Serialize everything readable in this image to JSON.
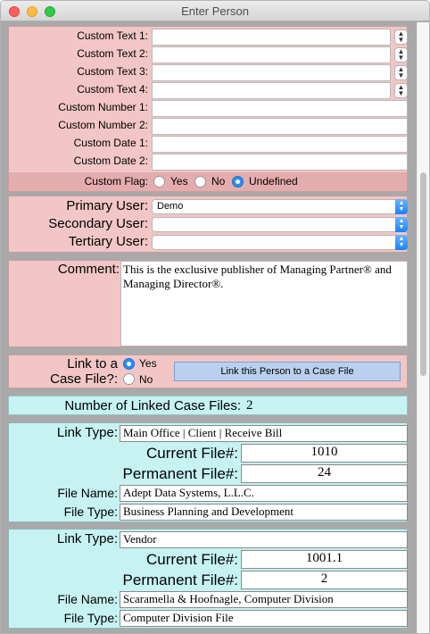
{
  "window": {
    "title": "Enter Person"
  },
  "custom": {
    "text1_label": "Custom Text 1:",
    "text2_label": "Custom Text 2:",
    "text3_label": "Custom Text 3:",
    "text4_label": "Custom Text 4:",
    "number1_label": "Custom Number 1:",
    "number2_label": "Custom Number 2:",
    "date1_label": "Custom Date 1:",
    "date2_label": "Custom Date 2:",
    "flag_label": "Custom Flag:",
    "flag_options": {
      "yes": "Yes",
      "no": "No",
      "undefined": "Undefined"
    },
    "flag_selected": "Undefined"
  },
  "users": {
    "primary_label": "Primary User:",
    "primary_value": "Demo",
    "secondary_label": "Secondary User:",
    "secondary_value": "",
    "tertiary_label": "Tertiary User:",
    "tertiary_value": ""
  },
  "comment": {
    "label": "Comment:",
    "text": "This is the exclusive publisher of Managing Partner® and Managing Director®."
  },
  "link": {
    "label_line1": "Link to a",
    "label_line2": "Case File?:",
    "yes": "Yes",
    "no": "No",
    "selected": "Yes",
    "button_label": "Link this Person to a Case File"
  },
  "linked": {
    "label": "Number of Linked Case Files:",
    "count": "2"
  },
  "case_labels": {
    "link_type": "Link Type:",
    "current_file": "Current File#:",
    "permanent_file": "Permanent File#:",
    "file_name": "File Name:",
    "file_type": "File Type:"
  },
  "cases": [
    {
      "link_type": "Main Office | Client | Receive Bill",
      "current_file": "1010",
      "permanent_file": "24",
      "file_name": "Adept Data Systems, L.L.C.",
      "file_type": "Business Planning and Development"
    },
    {
      "link_type": "Vendor",
      "current_file": "1001.1",
      "permanent_file": "2",
      "file_name": "Scaramella & Hoofnagle, Computer Division",
      "file_type": "Computer Division File"
    }
  ],
  "colors": {
    "pink": "#f2c6c6",
    "cyan": "#c6f2f2",
    "accent": "#2a8df5"
  }
}
